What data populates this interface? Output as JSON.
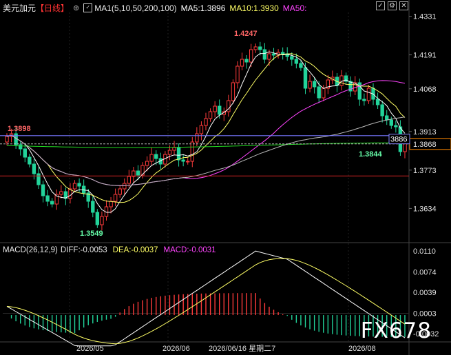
{
  "header": {
    "symbol": "美元加元",
    "period": "【日线】",
    "ma_label": "MA1(5,10,50,200,100)",
    "ma5": "MA5:1.3896",
    "ma10": "MA10:1.3930",
    "ma50": "MA50:"
  },
  "macd_header": {
    "title": "MACD(26,12,9)",
    "diff": "DIFF:-0.0053",
    "dea": "DEA:-0.0037",
    "macd": "MACD:-0.0031"
  },
  "watermark": "FX678",
  "icons": [
    "chart-toggle-icon",
    "checkbox-icon",
    "settings-icon",
    "close-icon"
  ],
  "colors": {
    "up": "#ff3b3b",
    "down": "#22d39a",
    "ma5": "#ffffff",
    "ma10": "#ffff66",
    "ma50": "#ff44ff",
    "ma_long": "#22dd22",
    "ma_other": "#bbbbbb",
    "diff": "#ffffff",
    "dea": "#ffff66"
  },
  "chart_data": {
    "type": "candlestick",
    "price_ticks": [
      "1.4331",
      "1.4191",
      "1.4068",
      "1.3913",
      "1.3773",
      "1.3634"
    ],
    "price_range": [
      1.352,
      1.4345
    ],
    "macd_ticks": [
      "0.0110",
      "0.0074",
      "0.0039",
      "0.0003",
      "-0.0032"
    ],
    "macd_range": [
      -0.0045,
      0.0115
    ],
    "x_labels": [
      "2026/05",
      "2026/06",
      "2026/06/16 星期二7",
      "2026/08"
    ],
    "annotations": {
      "high": "1.4247",
      "low": "1.3549",
      "left_level": "1.3898",
      "last_low": "1.3844",
      "current_price": "1.3868",
      "cursor_price": "1.3886"
    },
    "closes": [
      1.3895,
      1.3905,
      1.3865,
      1.385,
      1.382,
      1.3795,
      1.376,
      1.372,
      1.368,
      1.366,
      1.365,
      1.3685,
      1.3695,
      1.367,
      1.3705,
      1.3725,
      1.3715,
      1.369,
      1.366,
      1.362,
      1.3575,
      1.3605,
      1.364,
      1.366,
      1.3685,
      1.3705,
      1.3725,
      1.375,
      1.377,
      1.3755,
      1.379,
      1.3805,
      1.383,
      1.3815,
      1.3795,
      1.383,
      1.3845,
      1.3855,
      1.381,
      1.3805,
      1.3805,
      1.3875,
      1.3905,
      1.3935,
      1.396,
      1.3985,
      1.4005,
      1.3975,
      1.3985,
      1.4025,
      1.409,
      1.415,
      1.4175,
      1.4165,
      1.421,
      1.422,
      1.421,
      1.4175,
      1.4195,
      1.419,
      1.42,
      1.4195,
      1.4185,
      1.4175,
      1.416,
      1.4145,
      1.407,
      1.4095,
      1.4075,
      1.4035,
      1.407,
      1.41,
      1.411,
      1.408,
      1.4115,
      1.4095,
      1.406,
      1.409,
      1.403,
      1.4025,
      1.407,
      1.403,
      1.401,
      1.397,
      1.3955,
      1.3935,
      1.393,
      1.384,
      1.3872
    ],
    "ma_note": "MA5 1.3896, MA10 1.3930 at last bar"
  }
}
